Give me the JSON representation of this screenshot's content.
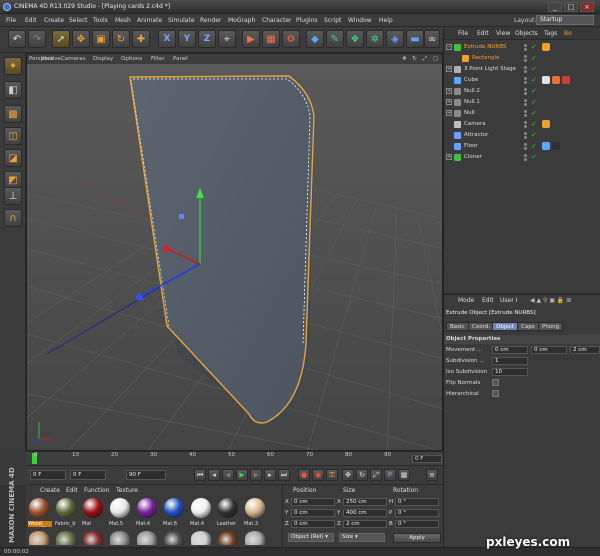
{
  "window": {
    "title": "CINEMA 4D R13.029 Studio - [Playing cards 2.c4d *]",
    "min": "_",
    "max": "□",
    "close": "×"
  },
  "menubar": [
    "File",
    "Edit",
    "Create",
    "Select",
    "Tools",
    "Mesh",
    "Animate",
    "Simulate",
    "Render",
    "MoGraph",
    "Character",
    "Plugins",
    "Script",
    "Window",
    "Help"
  ],
  "layout": {
    "label": "Layout:",
    "value": "Startup"
  },
  "viewport": {
    "label": "Perspective",
    "menu": [
      "View",
      "Cameras",
      "Display",
      "Options",
      "Filter",
      "Panel"
    ],
    "icons": "✥ ↻ ⤢ ▢"
  },
  "object_manager": {
    "menu": [
      "File",
      "Edit",
      "View",
      "Objects",
      "Tags",
      "Bo"
    ],
    "objects": [
      {
        "name": "Extrude NURBS",
        "indent": 0,
        "icon_color": "#40c040",
        "tree": "−",
        "selected": true,
        "tags": [
          "#f0a030"
        ]
      },
      {
        "name": "Rectangle",
        "indent": 1,
        "icon_color": "#f0a030",
        "tree": "",
        "selected": true,
        "tags": []
      },
      {
        "name": "3 Point Light Stage",
        "indent": 0,
        "icon_color": "#b0b0b0",
        "tree": "+",
        "selected": false,
        "tags": []
      },
      {
        "name": "Cube",
        "indent": 0,
        "icon_color": "#5aa8ff",
        "tree": "",
        "selected": false,
        "tags": [
          "#e0e0e0",
          "#f07030",
          "#c04040"
        ]
      },
      {
        "name": "Null.2",
        "indent": 0,
        "icon_color": "#8a8a8a",
        "tree": "+",
        "selected": false,
        "tags": []
      },
      {
        "name": "Null.1",
        "indent": 0,
        "icon_color": "#8a8a8a",
        "tree": "+",
        "selected": false,
        "tags": []
      },
      {
        "name": "Null",
        "indent": 0,
        "icon_color": "#8a8a8a",
        "tree": "+",
        "selected": false,
        "tags": []
      },
      {
        "name": "Camera",
        "indent": 0,
        "icon_color": "#c0c0c0",
        "tree": "",
        "selected": false,
        "tags": [
          "#f0a030"
        ]
      },
      {
        "name": "Attractor",
        "indent": 0,
        "icon_color": "#6aa0ff",
        "tree": "",
        "selected": false,
        "tags": []
      },
      {
        "name": "Floor",
        "indent": 0,
        "icon_color": "#6aa0ff",
        "tree": "",
        "selected": false,
        "tags": [
          "#5aa8ff",
          "#303030"
        ]
      },
      {
        "name": "Cloner",
        "indent": 0,
        "icon_color": "#40c040",
        "tree": "+",
        "selected": false,
        "tags": []
      }
    ]
  },
  "attributes": {
    "menu": [
      "Mode",
      "Edit",
      "User I"
    ],
    "title": "Extrude Object [Extrude NURBS]",
    "tabs": [
      "Basic",
      "Coord.",
      "Object",
      "Caps",
      "Phong"
    ],
    "active_tab": "Object",
    "section": "Object Properties",
    "movement_label": "Movement ...",
    "movement": [
      "0 cm",
      "0 cm",
      "2 cm"
    ],
    "subdivision_label": "Subdivision ...",
    "subdivision": "1",
    "iso_label": "Iso Subdivision",
    "iso": "10",
    "flip_label": "Flip Normals",
    "hier_label": "Hierarchical"
  },
  "timeline": {
    "ticks": [
      "0",
      "10",
      "20",
      "30",
      "40",
      "50",
      "60",
      "70",
      "80",
      "90"
    ],
    "end_label": "0 F"
  },
  "transport": {
    "start": "0 F",
    "cur": "0 F",
    "end": "90 F"
  },
  "materials": {
    "menu": [
      "Create",
      "Edit",
      "Function",
      "Texture"
    ],
    "items": [
      {
        "name": "Wood_",
        "color": "#a0522d",
        "selected": true
      },
      {
        "name": "Fabric_b",
        "color": "#5a6a3a",
        "selected": false
      },
      {
        "name": "Mat",
        "color": "#9a1010",
        "selected": false
      },
      {
        "name": "Mat.5",
        "color": "#e8e8e8",
        "selected": false
      },
      {
        "name": "Mat.4",
        "color": "#7a20a0",
        "selected": false
      },
      {
        "name": "Mat.6",
        "color": "#2050c0",
        "selected": false
      },
      {
        "name": "Mat.4",
        "color": "#f0f0f0",
        "selected": false
      },
      {
        "name": "Leather",
        "color": "#303030",
        "selected": false
      },
      {
        "name": "Mat.3",
        "color": "#d8b890",
        "selected": false
      }
    ],
    "row2_colors": [
      "#c8a070",
      "#6a7a4a",
      "#8a3030",
      "#909090",
      "#a0a0a0",
      "#505050",
      "#d0d0d0",
      "#704020",
      "#b0b0b0"
    ]
  },
  "coords": {
    "heads": [
      "Position",
      "Size",
      "Rotation"
    ],
    "rows": [
      {
        "axis": "X",
        "pos": "0 cm",
        "size_axis": "X",
        "size": "250 cm",
        "rot_axis": "H",
        "rot": "0 °"
      },
      {
        "axis": "Y",
        "pos": "0 cm",
        "size_axis": "Y",
        "size": "400 cm",
        "rot_axis": "P",
        "rot": "0 °"
      },
      {
        "axis": "Z",
        "pos": "0 cm",
        "size_axis": "Z",
        "size": "2 cm",
        "rot_axis": "B",
        "rot": "0 °"
      }
    ],
    "mode1": "Object (Rel) ▾",
    "mode2": "Size ▾",
    "apply": "Apply"
  },
  "status": {
    "time": "00:00:02"
  },
  "brand": {
    "maxon": "MAXON CINEMA 4D"
  },
  "watermark": "pxleyes.com"
}
